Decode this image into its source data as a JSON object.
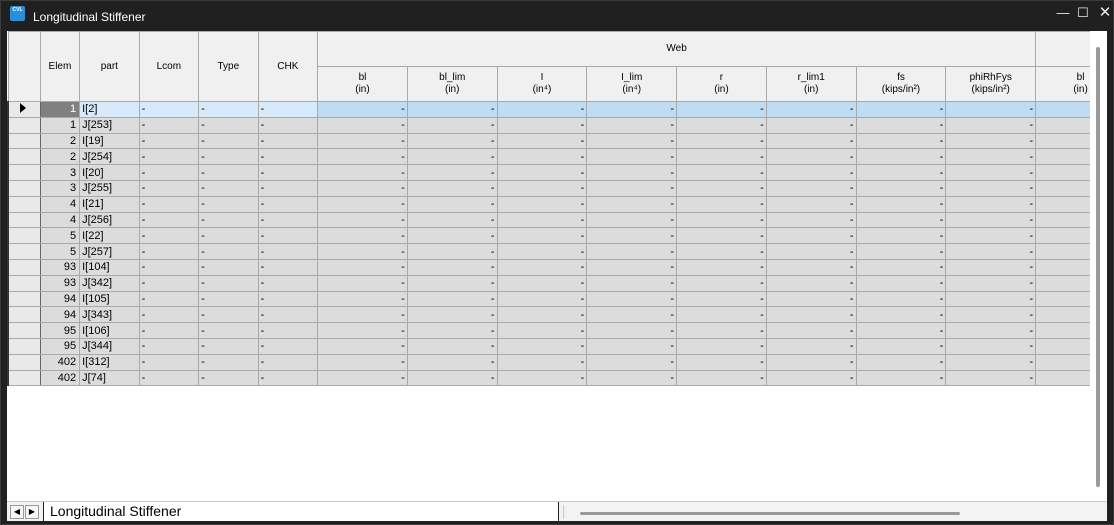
{
  "window": {
    "title": "Longitudinal Stiffener",
    "app_icon": "CVL",
    "controls": {
      "minimize": "—",
      "maximize": "☐",
      "close": "✕"
    }
  },
  "grid": {
    "group_header": "Web",
    "fixed_headers": [
      "Elem",
      "part",
      "Lcom",
      "Type",
      "CHK"
    ],
    "web_columns": [
      {
        "name": "bl",
        "unit": "(in)"
      },
      {
        "name": "bl_lim",
        "unit": "(in)"
      },
      {
        "name": "I",
        "unit": "(in⁴)"
      },
      {
        "name": "I_lim",
        "unit": "(in⁴)"
      },
      {
        "name": "r",
        "unit": "(in)"
      },
      {
        "name": "r_lim1",
        "unit": "(in)"
      },
      {
        "name": "fs",
        "unit": "(kips/in²)"
      },
      {
        "name": "phiRhFys",
        "unit": "(kips/in²)"
      },
      {
        "name": "bl",
        "unit": "(in)"
      }
    ],
    "rows": [
      {
        "elem": "1",
        "part": "I[2]",
        "lcom": "-",
        "type": "-",
        "chk": "-",
        "values": [
          "-",
          "-",
          "-",
          "-",
          "-",
          "-",
          "-",
          "-",
          "-"
        ]
      },
      {
        "elem": "1",
        "part": "J[253]",
        "lcom": "-",
        "type": "-",
        "chk": "-",
        "values": [
          "-",
          "-",
          "-",
          "-",
          "-",
          "-",
          "-",
          "-",
          "-"
        ]
      },
      {
        "elem": "2",
        "part": "I[19]",
        "lcom": "-",
        "type": "-",
        "chk": "-",
        "values": [
          "-",
          "-",
          "-",
          "-",
          "-",
          "-",
          "-",
          "-",
          "-"
        ]
      },
      {
        "elem": "2",
        "part": "J[254]",
        "lcom": "-",
        "type": "-",
        "chk": "-",
        "values": [
          "-",
          "-",
          "-",
          "-",
          "-",
          "-",
          "-",
          "-",
          "-"
        ]
      },
      {
        "elem": "3",
        "part": "I[20]",
        "lcom": "-",
        "type": "-",
        "chk": "-",
        "values": [
          "-",
          "-",
          "-",
          "-",
          "-",
          "-",
          "-",
          "-",
          "-"
        ]
      },
      {
        "elem": "3",
        "part": "J[255]",
        "lcom": "-",
        "type": "-",
        "chk": "-",
        "values": [
          "-",
          "-",
          "-",
          "-",
          "-",
          "-",
          "-",
          "-",
          "-"
        ]
      },
      {
        "elem": "4",
        "part": "I[21]",
        "lcom": "-",
        "type": "-",
        "chk": "-",
        "values": [
          "-",
          "-",
          "-",
          "-",
          "-",
          "-",
          "-",
          "-",
          "-"
        ]
      },
      {
        "elem": "4",
        "part": "J[256]",
        "lcom": "-",
        "type": "-",
        "chk": "-",
        "values": [
          "-",
          "-",
          "-",
          "-",
          "-",
          "-",
          "-",
          "-",
          "-"
        ]
      },
      {
        "elem": "5",
        "part": "I[22]",
        "lcom": "-",
        "type": "-",
        "chk": "-",
        "values": [
          "-",
          "-",
          "-",
          "-",
          "-",
          "-",
          "-",
          "-",
          "-"
        ]
      },
      {
        "elem": "5",
        "part": "J[257]",
        "lcom": "-",
        "type": "-",
        "chk": "-",
        "values": [
          "-",
          "-",
          "-",
          "-",
          "-",
          "-",
          "-",
          "-",
          "-"
        ]
      },
      {
        "elem": "93",
        "part": "I[104]",
        "lcom": "-",
        "type": "-",
        "chk": "-",
        "values": [
          "-",
          "-",
          "-",
          "-",
          "-",
          "-",
          "-",
          "-",
          "-"
        ]
      },
      {
        "elem": "93",
        "part": "J[342]",
        "lcom": "-",
        "type": "-",
        "chk": "-",
        "values": [
          "-",
          "-",
          "-",
          "-",
          "-",
          "-",
          "-",
          "-",
          "-"
        ]
      },
      {
        "elem": "94",
        "part": "I[105]",
        "lcom": "-",
        "type": "-",
        "chk": "-",
        "values": [
          "-",
          "-",
          "-",
          "-",
          "-",
          "-",
          "-",
          "-",
          "-"
        ]
      },
      {
        "elem": "94",
        "part": "J[343]",
        "lcom": "-",
        "type": "-",
        "chk": "-",
        "values": [
          "-",
          "-",
          "-",
          "-",
          "-",
          "-",
          "-",
          "-",
          "-"
        ]
      },
      {
        "elem": "95",
        "part": "I[106]",
        "lcom": "-",
        "type": "-",
        "chk": "-",
        "values": [
          "-",
          "-",
          "-",
          "-",
          "-",
          "-",
          "-",
          "-",
          "-"
        ]
      },
      {
        "elem": "95",
        "part": "J[344]",
        "lcom": "-",
        "type": "-",
        "chk": "-",
        "values": [
          "-",
          "-",
          "-",
          "-",
          "-",
          "-",
          "-",
          "-",
          "-"
        ]
      },
      {
        "elem": "402",
        "part": "I[312]",
        "lcom": "-",
        "type": "-",
        "chk": "-",
        "values": [
          "-",
          "-",
          "-",
          "-",
          "-",
          "-",
          "-",
          "-",
          "-"
        ]
      },
      {
        "elem": "402",
        "part": "J[74]",
        "lcom": "-",
        "type": "-",
        "chk": "-",
        "values": [
          "-",
          "-",
          "-",
          "-",
          "-",
          "-",
          "-",
          "-",
          "-"
        ]
      }
    ]
  },
  "sheet_tabs": {
    "nav_prev": "◀",
    "nav_next": "▶",
    "active_tab": "Longitudinal Stiffener"
  },
  "colors": {
    "title_bar": "#202020",
    "selected_row": "#bfdcf5",
    "cell_background": "#dcdcdc"
  }
}
